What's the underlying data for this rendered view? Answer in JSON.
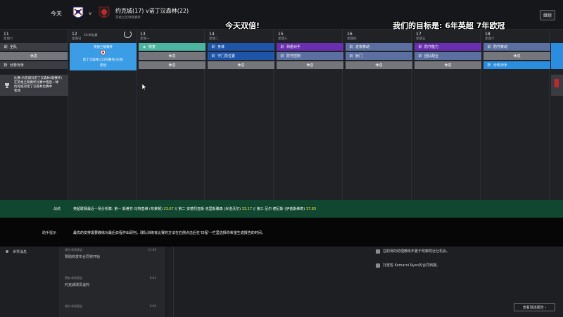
{
  "header": {
    "today_label": "今天",
    "vs_label": "v",
    "match_title": "约克城(17) v诺丁汉森林(22)",
    "match_subtitle": "英格兰足球联赛杯",
    "continue_label": "继续",
    "overlay_left": "今天双倍!",
    "overlay_right": "我们的目标是: 6年英超 7年欧冠"
  },
  "calendar": {
    "days": [
      {
        "num": "11",
        "weekday": "星期六"
      },
      {
        "num": "12",
        "weekday": "星期日",
        "extra": "10:00比赛"
      },
      {
        "num": "13",
        "weekday": "星期一"
      },
      {
        "num": "14",
        "weekday": "星期二"
      },
      {
        "num": "15",
        "weekday": "星期三"
      },
      {
        "num": "16",
        "weekday": "星期四"
      },
      {
        "num": "17",
        "weekday": "星期五"
      },
      {
        "num": "18",
        "weekday": "星期六"
      }
    ],
    "col1": [
      {
        "icon": "训",
        "label": "全队"
      },
      {
        "icon": "",
        "label": "休息"
      },
      {
        "icon": "析",
        "label": "分析对手"
      }
    ],
    "match_card": {
      "line1": "英格兰联赛杯",
      "line2": "诺丁汉森林(22)的赛场(主场)",
      "line3": "客场"
    },
    "news_card": {
      "line1": "比赛:约克城对诺丁汉森林(联赛杯)",
      "line2": "在英格兰联赛杯比赛中落后一球",
      "line3": "约克城对诺丁汉森林比赛中",
      "line4": "客场"
    },
    "col3": [
      {
        "icon": "◈",
        "label": "恢复"
      },
      {
        "icon": "",
        "label": "休息"
      },
      {
        "icon": "",
        "label": "休息"
      }
    ],
    "col4": [
      {
        "icon": "训",
        "label": "身体"
      },
      {
        "icon": "训",
        "label": "守门员位置"
      },
      {
        "icon": "",
        "label": "休息"
      }
    ],
    "col5": [
      {
        "icon": "训",
        "label": "熟悉对手"
      },
      {
        "icon": "训",
        "label": "防守控制"
      },
      {
        "icon": "",
        "label": "休息"
      }
    ],
    "col6": [
      {
        "icon": "训",
        "label": "进攻移动"
      },
      {
        "icon": "训",
        "label": "射门"
      },
      {
        "icon": "",
        "label": "休息"
      }
    ],
    "col7": [
      {
        "icon": "训",
        "label": "防守能力"
      },
      {
        "icon": "训",
        "label": "团队配合"
      },
      {
        "icon": "",
        "label": "休息"
      }
    ],
    "col8": [
      {
        "icon": "训",
        "label": "防守移动"
      },
      {
        "icon": "",
        "label": "休息"
      },
      {
        "icon": "析",
        "label": "分析对手"
      }
    ]
  },
  "result_bar": {
    "label": "战绩",
    "text_prefix": "英超联赛最近一场分析数: 第一 斯蒂芬·马特基维 (布莱顿)",
    "score1": "23.67",
    "text_mid1": "// 第二 安德烈亚斯·克里斯滕森 (米洛沃尔)",
    "score2": "33.17",
    "text_mid2": "// 第三 尼尔·德尼斯 (伊普斯维奇)",
    "score3": "37.83"
  },
  "info_bar": {
    "label": "助手提示",
    "text": "最优的安排需要教练对最后日程作出研判。球队训练有比赛的方法在右侧点击后在'日程'一栏里选择你希望生成报告的时间。"
  },
  "lower": {
    "left_label": "世界消息",
    "feed": [
      {
        "head": "球队·新闻报告",
        "time": "11:30",
        "body": "赞助商发布合同将开始"
      },
      {
        "head": "赞助·新闻报告",
        "time": "8:24",
        "body": "约克城球员谈判"
      },
      {
        "head": "球队·新闻报告",
        "time": "8:00",
        "body": ""
      }
    ],
    "notifications": [
      "在职场的助理教练布置于政策附近仕机会。",
      "托雷哲·Komarni Ryan的合同到期。"
    ],
    "done_label": "查看球迷报告 ›"
  }
}
